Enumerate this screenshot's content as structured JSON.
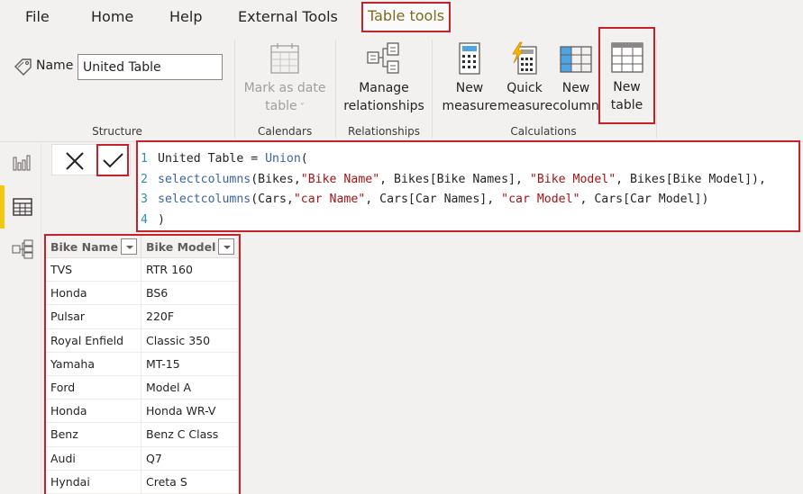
{
  "menu": {
    "tabs": [
      {
        "label": "File"
      },
      {
        "label": "Home"
      },
      {
        "label": "Help"
      },
      {
        "label": "External Tools"
      },
      {
        "label": "Table tools",
        "active": true
      }
    ]
  },
  "ribbon": {
    "structure": {
      "name_label": "Name",
      "name_value": "United Table",
      "group_label": "Structure"
    },
    "calendars": {
      "mark_as_date_table_line1": "Mark as date",
      "mark_as_date_table_line2": "table",
      "group_label": "Calendars"
    },
    "relationships": {
      "manage_line1": "Manage",
      "manage_line2": "relationships",
      "group_label": "Relationships"
    },
    "calculations": {
      "new_measure_line1": "New",
      "new_measure_line2": "measure",
      "quick_measure_line1": "Quick",
      "quick_measure_line2": "measure",
      "new_column_line1": "New",
      "new_column_line2": "column",
      "new_table_line1": "New",
      "new_table_line2": "table",
      "group_label": "Calculations"
    }
  },
  "colors": {
    "highlight": "#c7222b",
    "active_nav": "#f2c811",
    "active_tab_text": "#7d6b20"
  },
  "formula": {
    "lines": [
      {
        "num": "1",
        "parts": [
          {
            "t": "United Table = ",
            "c": ""
          },
          {
            "t": "Union",
            "c": "kw"
          },
          {
            "t": "(",
            "c": ""
          }
        ]
      },
      {
        "num": "2",
        "parts": [
          {
            "t": "selectcolumns",
            "c": "kw"
          },
          {
            "t": "(Bikes,",
            "c": ""
          },
          {
            "t": "\"Bike Name\"",
            "c": "str"
          },
          {
            "t": ", Bikes[Bike Names], ",
            "c": ""
          },
          {
            "t": "\"Bike Model\"",
            "c": "str"
          },
          {
            "t": ", Bikes[Bike Model]),",
            "c": ""
          }
        ]
      },
      {
        "num": "3",
        "parts": [
          {
            "t": "selectcolumns",
            "c": "kw"
          },
          {
            "t": "(Cars,",
            "c": ""
          },
          {
            "t": "\"car Name\"",
            "c": "str"
          },
          {
            "t": ", Cars[Car Names], ",
            "c": ""
          },
          {
            "t": "\"car Model\"",
            "c": "str"
          },
          {
            "t": ", Cars[Car Model])",
            "c": ""
          }
        ]
      },
      {
        "num": "4",
        "parts": [
          {
            "t": ")",
            "c": ""
          }
        ]
      }
    ]
  },
  "table": {
    "columns": [
      "Bike Name",
      "Bike Model"
    ],
    "rows": [
      [
        "TVS",
        "RTR 160"
      ],
      [
        "Honda",
        "BS6"
      ],
      [
        "Pulsar",
        "220F"
      ],
      [
        "Royal Enfield",
        "Classic 350"
      ],
      [
        "Yamaha",
        "MT-15"
      ],
      [
        "Ford",
        "Model A"
      ],
      [
        "Honda",
        "Honda WR-V"
      ],
      [
        "Benz",
        "Benz C Class"
      ],
      [
        "Audi",
        "Q7"
      ],
      [
        "Hyndai",
        "Creta S"
      ]
    ]
  }
}
